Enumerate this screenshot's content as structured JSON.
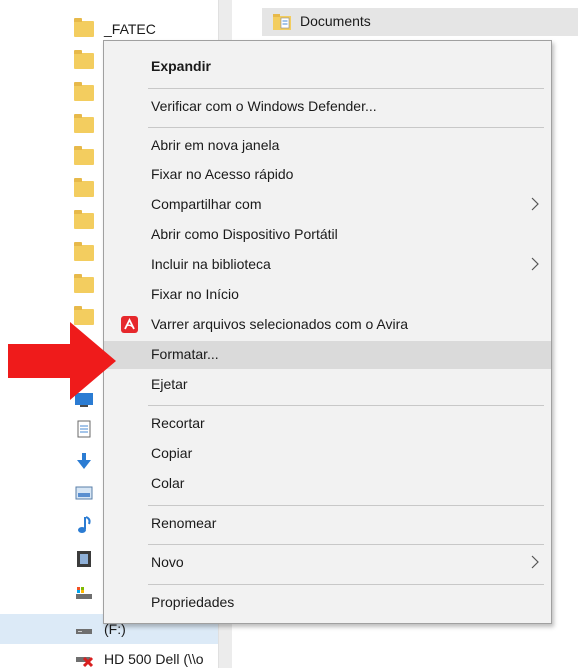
{
  "nav_pane": {
    "items": [
      {
        "label": "_FATEC",
        "icon": "folder-icon"
      },
      {
        "label": "",
        "icon": "folder-icon"
      },
      {
        "label": "",
        "icon": "folder-icon"
      },
      {
        "label": "",
        "icon": "folder-icon"
      },
      {
        "label": "",
        "icon": "folder-icon"
      },
      {
        "label": "",
        "icon": "folder-icon"
      },
      {
        "label": "",
        "icon": "folder-icon"
      },
      {
        "label": "",
        "icon": "folder-icon"
      },
      {
        "label": "",
        "icon": "folder-icon"
      },
      {
        "label": "",
        "icon": "folder-icon"
      },
      {
        "label": "",
        "icon": "folder-icon"
      },
      {
        "label": "",
        "icon": "desktop-icon"
      },
      {
        "label": "",
        "icon": "document-icon"
      },
      {
        "label": "",
        "icon": "download-icon"
      },
      {
        "label": "",
        "icon": "pictures-icon"
      },
      {
        "label": "",
        "icon": "music-icon"
      },
      {
        "label": "",
        "icon": "video-icon"
      },
      {
        "label": "",
        "icon": "local-disk-icon"
      },
      {
        "label": "(F:)",
        "icon": "drive-icon"
      },
      {
        "label": "HD 500 Dell (\\\\o",
        "icon": "network-drive-icon"
      }
    ]
  },
  "content": {
    "header_label": "Documents",
    "header_icon": "documents-folder-icon"
  },
  "context_menu": {
    "expand": "Expandir",
    "defender": "Verificar com o Windows Defender...",
    "open_new_window": "Abrir em nova janela",
    "pin_quick_access": "Fixar no Acesso rápido",
    "share_with": "Compartilhar com",
    "open_portable": "Abrir como Dispositivo Portátil",
    "include_library": "Incluir na biblioteca",
    "pin_start": "Fixar no Início",
    "avira_scan": "Varrer arquivos selecionados com o Avira",
    "format": "Formatar...",
    "eject": "Ejetar",
    "cut": "Recortar",
    "copy": "Copiar",
    "paste": "Colar",
    "rename": "Renomear",
    "new": "Novo",
    "properties": "Propriedades"
  },
  "colors": {
    "menu_background": "#f2f2f2",
    "hover_highlight": "#dadada",
    "selection_highlight": "#dceaf7",
    "annotation_arrow": "#ef1b1b",
    "avira_red": "#e6282c",
    "folder_yellow": "#f3cd5f"
  }
}
